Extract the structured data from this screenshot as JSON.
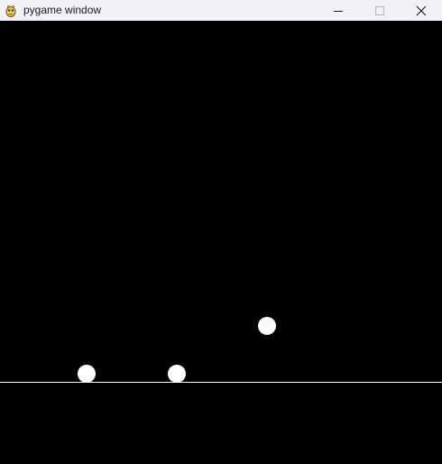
{
  "window": {
    "title": "pygame window",
    "icon": "pygame-snake-icon"
  },
  "controls": {
    "minimize_icon": "minimize-icon",
    "maximize_icon": "maximize-icon",
    "close_icon": "close-icon"
  },
  "colors": {
    "titlebar_bg": "#f0f2f7",
    "canvas_bg": "#000000",
    "ball": "#ffffff",
    "ground_line": "#ffffff"
  },
  "scene": {
    "ball_count": 3
  }
}
